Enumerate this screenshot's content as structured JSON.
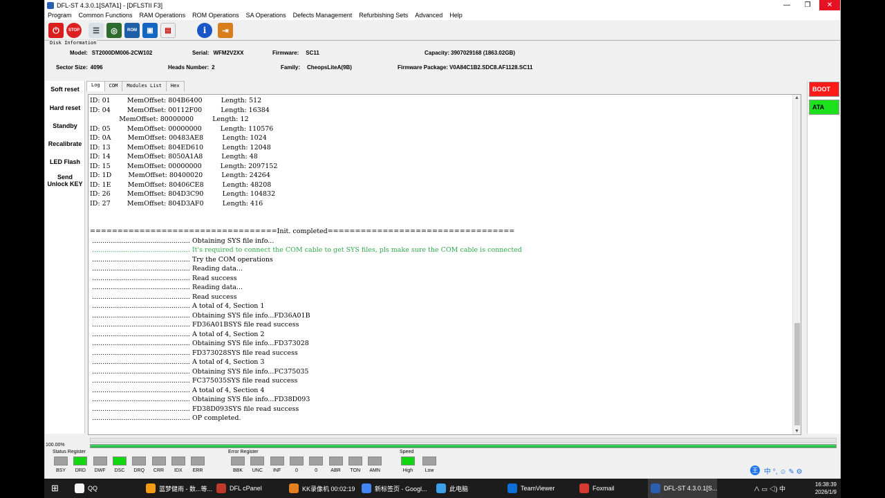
{
  "window": {
    "title": "DFL-ST 4.3.0.1[SATA1] - [DFLSTII  F3]"
  },
  "menu": [
    "Program",
    "Common Functions",
    "RAM Operations",
    "ROM Operations",
    "SA Operations",
    "Defects Management",
    "Refurbishing Sets",
    "Advanced",
    "Help"
  ],
  "disk_info": {
    "group_title": "Disk Information",
    "model_label": "Model:",
    "model": "ST2000DM006-2CW102",
    "serial_label": "Serial:",
    "serial": "WFM2V2XX",
    "firmware_label": "Firmware:",
    "firmware": "SC11",
    "capacity_label": "Capacity:",
    "capacity": "3907029168 (1863.02GB)",
    "sector_label": "Sector Size:",
    "sector": "4096",
    "heads_label": "Heads Number:",
    "heads": "2",
    "family_label": "Family:",
    "family": "CheopsLiteA(9B)",
    "fwpkg_label": "Firmware Package:",
    "fwpkg": "V0A84C1B2.SDC8.AF1128.SC11"
  },
  "left_buttons": [
    "Soft reset",
    "Hard reset",
    "Standby",
    "Recalibrate",
    "LED Flash",
    "Send\nUnlock KEY"
  ],
  "tabs": [
    "Log",
    "COM",
    "Modules List",
    "Hex"
  ],
  "right_buttons": [
    {
      "label": "BOOT",
      "color": "#ff1a1a"
    },
    {
      "label": "ATA",
      "color": "#1ee11e"
    }
  ],
  "log_lines": [
    {
      "t": "ID: 01        MemOffset: 804B6400         Length: 512"
    },
    {
      "t": "ID: 04        MemOffset: 00112F00         Length: 16384"
    },
    {
      "t": "              MemOffset: 80000000         Length: 12"
    },
    {
      "t": "ID: 05        MemOffset: 00000000         Length: 110576"
    },
    {
      "t": "ID: 0A        MemOffset: 00483AE8         Length: 1024"
    },
    {
      "t": "ID: 13        MemOffset: 804ED610         Length: 12048"
    },
    {
      "t": "ID: 14        MemOffset: 8050A1A8         Length: 48"
    },
    {
      "t": "ID: 15        MemOffset: 00000000         Length: 2097152"
    },
    {
      "t": "ID: 1D        MemOffset: 80400020         Length: 24264"
    },
    {
      "t": "ID: 1E        MemOffset: 80406CE8         Length: 48208"
    },
    {
      "t": "ID: 26        MemOffset: 804D3C90         Length: 104832"
    },
    {
      "t": "ID: 27        MemOffset: 804D3AF0         Length: 416"
    },
    {
      "t": ""
    },
    {
      "t": ""
    },
    {
      "t": "==================================Init. completed=================================="
    },
    {
      "t": " ............................................... Obtaining SYS file info..."
    },
    {
      "t": " ............................................... It's required to connect the COM cable to get SYS files, pls make sure the COM cable is connected",
      "c": "gr"
    },
    {
      "t": " ............................................... Try the COM operations"
    },
    {
      "t": " ............................................... Reading data..."
    },
    {
      "t": " ............................................... Read success"
    },
    {
      "t": " ............................................... Reading data..."
    },
    {
      "t": " ............................................... Read success"
    },
    {
      "t": " ............................................... A total of 4, Section 1"
    },
    {
      "t": " ............................................... Obtaining SYS file info...FD36A01B"
    },
    {
      "t": " ............................................... FD36A01BSYS file read success"
    },
    {
      "t": " ............................................... A total of 4, Section 2"
    },
    {
      "t": " ............................................... Obtaining SYS file info...FD373028"
    },
    {
      "t": " ............................................... FD373028SYS file read success"
    },
    {
      "t": " ............................................... A total of 4, Section 3"
    },
    {
      "t": " ............................................... Obtaining SYS file info...FC375035"
    },
    {
      "t": " ............................................... FC375035SYS file read success"
    },
    {
      "t": " ............................................... A total of 4, Section 4"
    },
    {
      "t": " ............................................... Obtaining SYS file info...FD38D093"
    },
    {
      "t": " ............................................... FD38D093SYS file read success"
    },
    {
      "t": " ............................................... OP completed."
    }
  ],
  "progress": {
    "label": "100.00%",
    "fraction": 1.0
  },
  "status_register": {
    "title": "Status Register",
    "leds": [
      {
        "l": "BSY",
        "on": false
      },
      {
        "l": "DRD",
        "on": true
      },
      {
        "l": "DWF",
        "on": false
      },
      {
        "l": "DSC",
        "on": true
      },
      {
        "l": "DRQ",
        "on": false
      },
      {
        "l": "CRR",
        "on": false
      },
      {
        "l": "IDX",
        "on": false
      },
      {
        "l": "ERR",
        "on": false
      }
    ]
  },
  "error_register": {
    "title": "Error Register",
    "leds": [
      {
        "l": "BBK",
        "on": false
      },
      {
        "l": "UNC",
        "on": false
      },
      {
        "l": "INF",
        "on": false
      },
      {
        "l": "0",
        "on": false
      },
      {
        "l": "0",
        "on": false
      },
      {
        "l": "ABR",
        "on": false
      },
      {
        "l": "TON",
        "on": false
      },
      {
        "l": "AMN",
        "on": false
      }
    ]
  },
  "speed": {
    "title": "Speed",
    "leds": [
      {
        "l": "High",
        "on": true
      },
      {
        "l": "Low",
        "on": false
      }
    ]
  },
  "taskbar": {
    "items": [
      {
        "label": "QQ",
        "color": "#f5f5f5"
      },
      {
        "label": "蓝梦健雨 - 数...等...",
        "color": "#f39c12"
      },
      {
        "label": "DFL cPanel",
        "color": "#c0392b"
      },
      {
        "label": "KK录像机 00:02:19",
        "color": "#e67e22"
      },
      {
        "label": "新标签页 - Googl...",
        "color": "#4285f4"
      },
      {
        "label": "此电脑",
        "color": "#3aa0e8"
      },
      {
        "label": "TeamViewer",
        "color": "#0e6fd8"
      },
      {
        "label": "Foxmail",
        "color": "#d63a2f"
      },
      {
        "label": "DFL-ST 4.3.0.1[S...",
        "color": "#2a5fb0"
      }
    ],
    "tray": "∧  ▭  ◁)  中",
    "time": "16:38:39",
    "date": "2026/1/9"
  },
  "ime_bar": "中 °, ☺ ✎ ⚙"
}
